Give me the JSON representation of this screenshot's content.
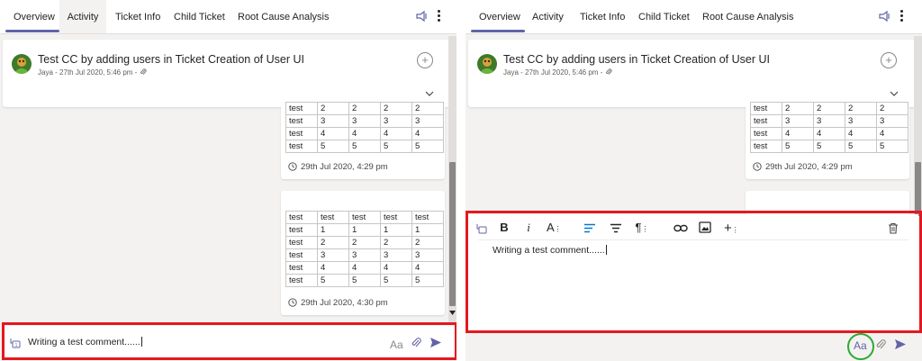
{
  "tabs": [
    "Overview",
    "Activity",
    "Ticket Info",
    "Child Ticket",
    "Root Cause Analysis"
  ],
  "ticket": {
    "title": "Test CC by adding users in Ticket Creation of User UI",
    "author": "Jaya",
    "date": "27th Jul 2020, 5:46 pm",
    "separator": "-",
    "separator2": "·"
  },
  "table1": {
    "rows": [
      [
        "test",
        "2",
        "2",
        "2",
        "2"
      ],
      [
        "test",
        "3",
        "3",
        "3",
        "3"
      ],
      [
        "test",
        "4",
        "4",
        "4",
        "4"
      ],
      [
        "test",
        "5",
        "5",
        "5",
        "5"
      ]
    ],
    "timestamp": "29th Jul 2020, 4:29 pm"
  },
  "table2": {
    "rows": [
      [
        "test",
        "test",
        "test",
        "test",
        "test"
      ],
      [
        "test",
        "1",
        "1",
        "1",
        "1"
      ],
      [
        "test",
        "2",
        "2",
        "2",
        "2"
      ],
      [
        "test",
        "3",
        "3",
        "3",
        "3"
      ],
      [
        "test",
        "4",
        "4",
        "4",
        "4"
      ],
      [
        "test",
        "5",
        "5",
        "5",
        "5"
      ]
    ],
    "timestamp": "29th Jul 2020, 4:30 pm"
  },
  "compose": {
    "text": "Writing a test comment......",
    "format_label": "Aa"
  },
  "toolbar": {
    "bold": "B",
    "italic": "i",
    "font_size": "A",
    "more": "+"
  },
  "colors": {
    "accent": "#6264a7",
    "highlight_red": "#e3191f",
    "highlight_green": "#2bab33",
    "toolbar_active": "#0078d4"
  },
  "icons": {
    "pin": "pin-icon",
    "kebab": "more-options-icon",
    "add": "plus-circle-icon",
    "expand": "chevron-down-icon",
    "clock": "clock-icon",
    "attach": "paperclip-icon",
    "send": "send-icon",
    "delete": "trash-icon"
  }
}
